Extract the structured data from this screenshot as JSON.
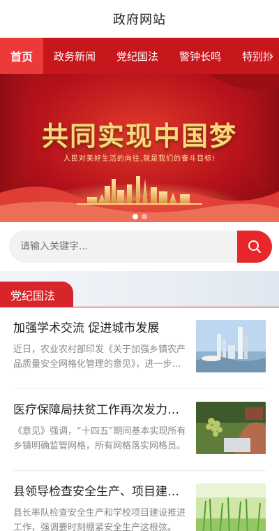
{
  "header": {
    "title": "政府网站"
  },
  "nav": {
    "items": [
      {
        "label": "首页",
        "active": true
      },
      {
        "label": "政务新闻",
        "active": false
      },
      {
        "label": "党纪国法",
        "active": false
      },
      {
        "label": "警钟长鸣",
        "active": false
      },
      {
        "label": "特别推荐",
        "active": false
      }
    ],
    "more_icon": "chevron-right-icon",
    "more_glyph": "›"
  },
  "banner": {
    "headline": "共同实现中国梦",
    "slogan": "人民对美好生活的向往,就是我们的奋斗目标!",
    "slide_count": 2,
    "active_slide": 1
  },
  "search": {
    "placeholder": "请输入关键字...",
    "icon": "search-icon"
  },
  "section": {
    "title": "党纪国法"
  },
  "articles": [
    {
      "title": "加强学术交流 促进城市发展",
      "desc": "近日，农业农村部印发《关于加强乡镇农产品质量安全网格化管理的意见》，进一步推进基层监管工作。",
      "thumb": "city-skyline-image"
    },
    {
      "title": "医疗保障局扶贫工作再次发力，取得新成效",
      "desc": "《意见》强调，“十四五”期间基本实现所有乡镇明确监管网格，所有网格落实网格员。",
      "thumb": "grapes-harvest-image"
    },
    {
      "title": "县领导检查安全生产、项目建设工作",
      "desc": "县长率队检查安全生产和学校项目建设推进工作，强调要时刻绷紧安全生产这根弦。",
      "thumb": "green-field-image"
    }
  ],
  "colors": {
    "brand_red": "#c8161d",
    "accent_red": "#e8272d",
    "gold": "#f9d77e"
  }
}
